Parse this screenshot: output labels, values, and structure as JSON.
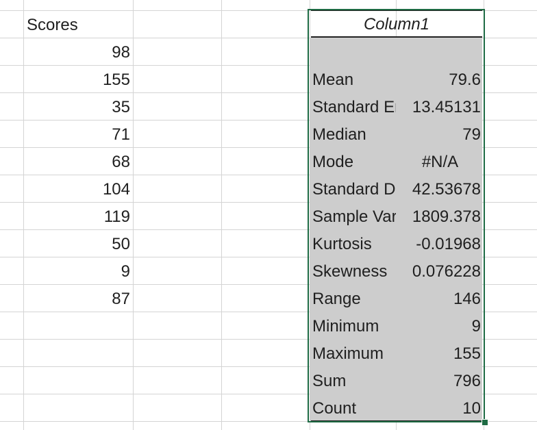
{
  "sheet": {
    "scores_header": "Scores",
    "scores": [
      "98",
      "155",
      "35",
      "71",
      "68",
      "104",
      "119",
      "50",
      "9",
      "87"
    ]
  },
  "stats_table": {
    "header": "Column1",
    "rows": [
      {
        "label": "Mean",
        "value": "79.6"
      },
      {
        "label": "Standard Error",
        "value": "13.45131"
      },
      {
        "label": "Median",
        "value": "79"
      },
      {
        "label": "Mode",
        "value": "#N/A"
      },
      {
        "label": "Standard Deviation",
        "value": "42.53678"
      },
      {
        "label": "Sample Variance",
        "value": "1809.378"
      },
      {
        "label": "Kurtosis",
        "value": "-0.01968"
      },
      {
        "label": "Skewness",
        "value": "0.076228"
      },
      {
        "label": "Range",
        "value": "146"
      },
      {
        "label": "Minimum",
        "value": "9"
      },
      {
        "label": "Maximum",
        "value": "155"
      },
      {
        "label": "Sum",
        "value": "796"
      },
      {
        "label": "Count",
        "value": "10"
      }
    ]
  },
  "colors": {
    "selection_fill": "#cdcdcd",
    "selection_border": "#1e6b44",
    "gridline": "#d4d4d4"
  }
}
